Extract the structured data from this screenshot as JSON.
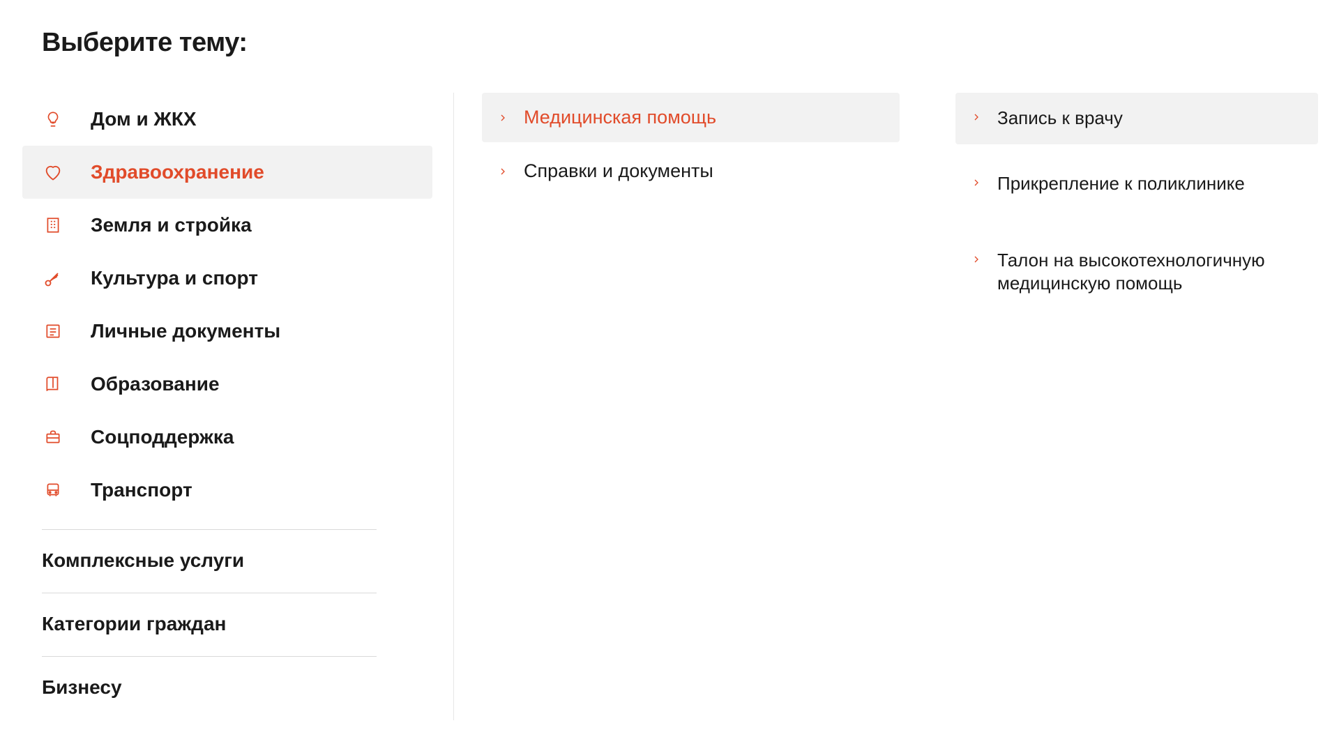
{
  "heading": "Выберите тему:",
  "accent": "#e14b2a",
  "left": {
    "categories": [
      {
        "icon": "lightbulb",
        "label": "Дом и ЖКХ",
        "active": false
      },
      {
        "icon": "heart",
        "label": "Здравоохранение",
        "active": true
      },
      {
        "icon": "building",
        "label": "Земля и стройка",
        "active": false
      },
      {
        "icon": "shuttlecock",
        "label": "Культура и спорт",
        "active": false
      },
      {
        "icon": "document",
        "label": "Личные документы",
        "active": false
      },
      {
        "icon": "book",
        "label": "Образование",
        "active": false
      },
      {
        "icon": "briefcase",
        "label": "Соцподдержка",
        "active": false
      },
      {
        "icon": "bus",
        "label": "Транспорт",
        "active": false
      }
    ],
    "extras": [
      "Комплексные услуги",
      "Категории граждан",
      "Бизнесу"
    ]
  },
  "middle": {
    "items": [
      {
        "label": "Медицинская помощь",
        "active": true
      },
      {
        "label": "Справки и документы",
        "active": false
      }
    ]
  },
  "right": {
    "items": [
      {
        "label": "Запись к врачу",
        "active": true
      },
      {
        "label": "Прикрепление к поликлинике",
        "active": false
      },
      {
        "label": "Талон на высокотехнологичную медицинскую помощь",
        "active": false
      }
    ]
  }
}
